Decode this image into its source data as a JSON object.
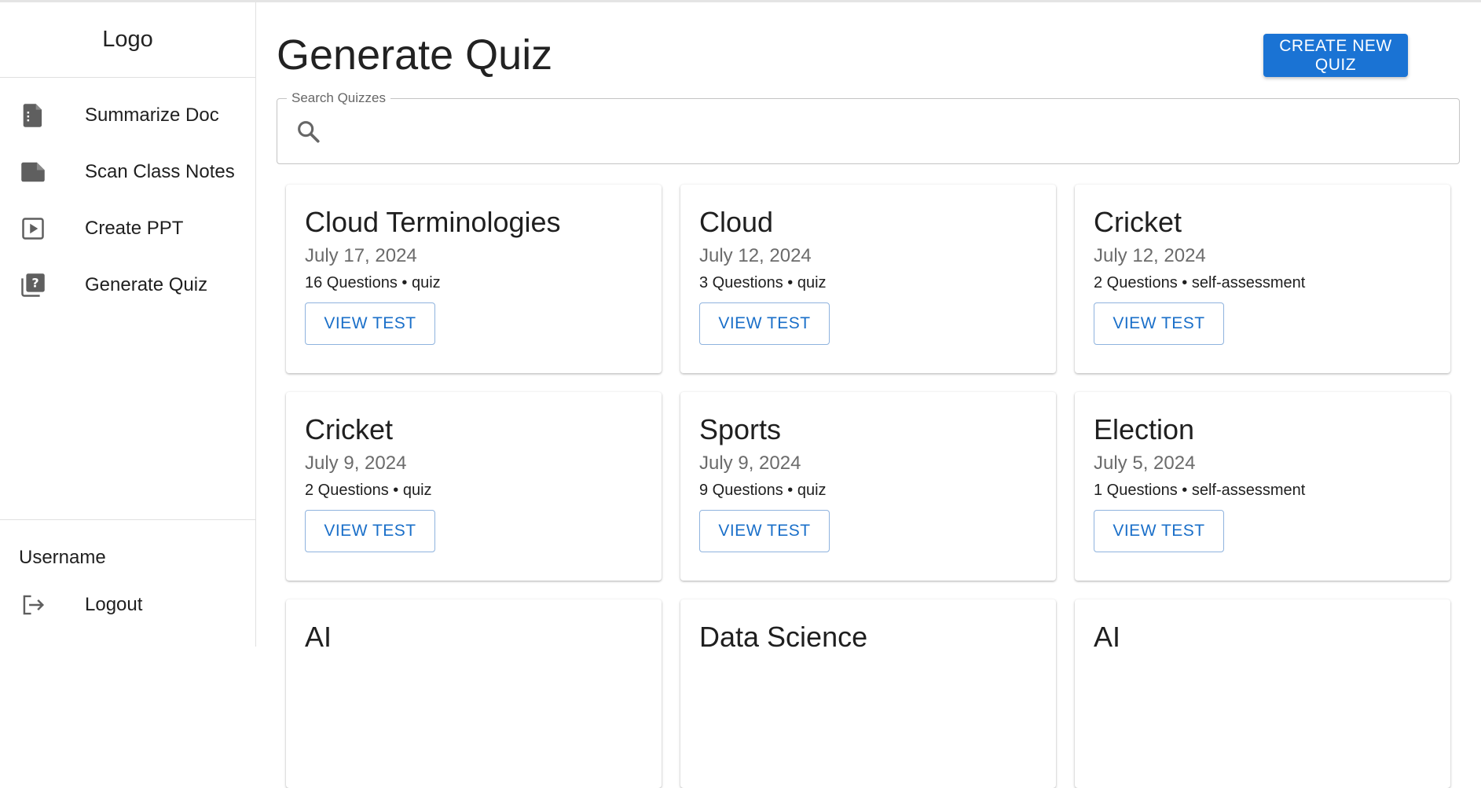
{
  "sidebar": {
    "logo": "Logo",
    "items": [
      {
        "label": "Summarize Doc",
        "icon": "document-icon"
      },
      {
        "label": "Scan Class Notes",
        "icon": "note-icon"
      },
      {
        "label": "Create PPT",
        "icon": "slideshow-icon"
      },
      {
        "label": "Generate Quiz",
        "icon": "quiz-icon"
      }
    ],
    "username": "Username",
    "logout_label": "Logout"
  },
  "main": {
    "title": "Generate Quiz",
    "create_button": "CREATE NEW QUIZ",
    "search": {
      "legend": "Search Quizzes",
      "value": ""
    },
    "view_label": "VIEW TEST",
    "cards": [
      {
        "title": "Cloud Terminologies",
        "date": "July 17, 2024",
        "meta": "16 Questions • quiz"
      },
      {
        "title": "Cloud",
        "date": "July 12, 2024",
        "meta": "3 Questions • quiz"
      },
      {
        "title": "Cricket",
        "date": "July 12, 2024",
        "meta": "2 Questions • self-assessment"
      },
      {
        "title": "Cricket",
        "date": "July 9, 2024",
        "meta": "2 Questions • quiz"
      },
      {
        "title": "Sports",
        "date": "July 9, 2024",
        "meta": "9 Questions • quiz"
      },
      {
        "title": "Election",
        "date": "July 5, 2024",
        "meta": "1 Questions • self-assessment"
      },
      {
        "title": "AI",
        "date": "",
        "meta": ""
      },
      {
        "title": "Data Science",
        "date": "",
        "meta": ""
      },
      {
        "title": "AI",
        "date": "",
        "meta": ""
      }
    ]
  },
  "colors": {
    "accent": "#1a73d4",
    "icon": "#5f5f5f",
    "outline": "#8fb3de"
  }
}
